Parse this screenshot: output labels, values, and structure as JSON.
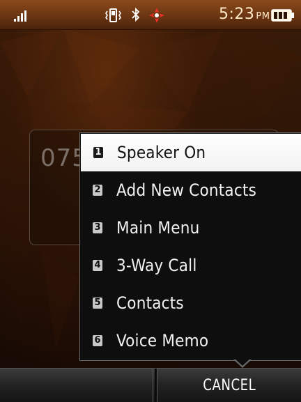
{
  "status_bar": {
    "icons": [
      "signal-icon",
      "vibrate-icon",
      "bluetooth-icon",
      "gps-icon",
      "battery-icon"
    ],
    "time": "5:23",
    "ampm": "PM"
  },
  "number_entry": {
    "value": "075"
  },
  "menu": {
    "selected_index": 0,
    "items": [
      {
        "number": "1",
        "label": "Speaker On"
      },
      {
        "number": "2",
        "label": "Add New Contacts"
      },
      {
        "number": "3",
        "label": "Main Menu"
      },
      {
        "number": "4",
        "label": "3-Way Call"
      },
      {
        "number": "5",
        "label": "Contacts"
      },
      {
        "number": "6",
        "label": "Voice Memo"
      }
    ]
  },
  "softkeys": {
    "left": "",
    "right": "CANCEL"
  },
  "colors": {
    "statusbar_top": "#8a4a1c",
    "background": "#2b1406",
    "menu_bg": "#0e0e0e",
    "selected_bg": "#ffffff"
  }
}
